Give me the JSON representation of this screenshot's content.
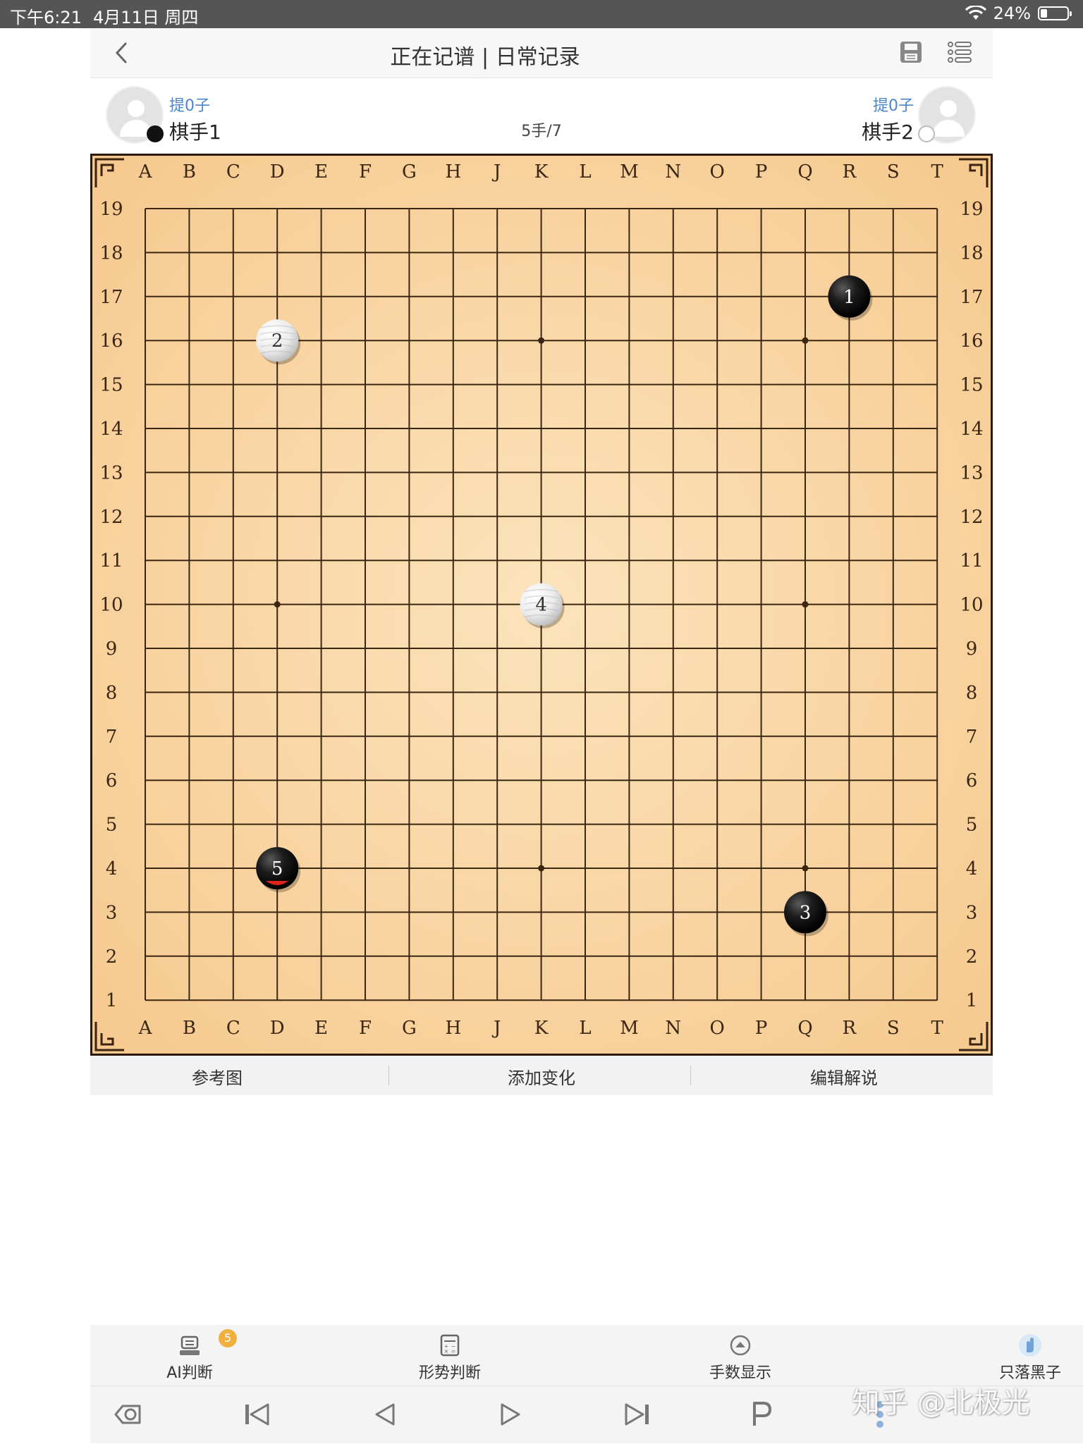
{
  "status_bar": {
    "time": "下午6:21",
    "date": "4月11日 周四",
    "battery": "24%",
    "battery_level": 0.24
  },
  "header": {
    "title": "正在记谱 | 日常记录",
    "icons": [
      "back-chevron-icon",
      "save-disk-icon",
      "list-menu-icon"
    ]
  },
  "players": {
    "black": {
      "name": "棋手1",
      "captures": "提0子"
    },
    "white": {
      "name": "棋手2",
      "captures": "提0子"
    },
    "move_counter": "5手/7"
  },
  "board": {
    "size": 19,
    "columns": [
      "A",
      "B",
      "C",
      "D",
      "E",
      "F",
      "G",
      "H",
      "J",
      "K",
      "L",
      "M",
      "N",
      "O",
      "P",
      "Q",
      "R",
      "S",
      "T"
    ],
    "rows": [
      "19",
      "18",
      "17",
      "16",
      "15",
      "14",
      "13",
      "12",
      "11",
      "10",
      "9",
      "8",
      "7",
      "6",
      "5",
      "4",
      "3",
      "2",
      "1"
    ],
    "star_points": [
      "D16",
      "K16",
      "Q16",
      "D10",
      "K10",
      "Q10",
      "D4",
      "K4",
      "Q4"
    ],
    "stones": [
      {
        "n": "1",
        "color": "black",
        "point": "R17"
      },
      {
        "n": "2",
        "color": "white",
        "point": "D16"
      },
      {
        "n": "3",
        "color": "black",
        "point": "Q3"
      },
      {
        "n": "4",
        "color": "white",
        "point": "K10"
      },
      {
        "n": "5",
        "color": "black",
        "point": "D4",
        "last": true
      }
    ]
  },
  "actions": [
    "参考图",
    "添加变化",
    "编辑解说"
  ],
  "toolbar": [
    {
      "label": "AI判断",
      "icon": "ai-robot-icon",
      "badge": "5"
    },
    {
      "label": "形势判断",
      "icon": "calculator-icon"
    },
    {
      "label": "手数显示",
      "icon": "circle-arrow-icon"
    },
    {
      "label": "只落黑子",
      "icon": "hand-stone-icon"
    }
  ],
  "nav_icons": [
    "undo-delete-icon",
    "first-move-icon",
    "prev-move-icon",
    "next-move-icon",
    "last-move-icon",
    "pass-icon",
    "more-icon"
  ],
  "watermark": "知乎 @北极光"
}
